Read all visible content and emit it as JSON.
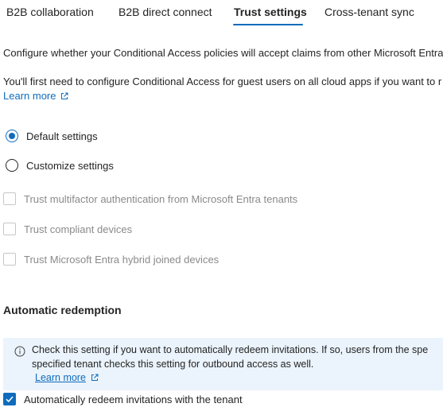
{
  "tabs": [
    {
      "label": "B2B collaboration",
      "active": false
    },
    {
      "label": "B2B direct connect",
      "active": false
    },
    {
      "label": "Trust settings",
      "active": true
    },
    {
      "label": "Cross-tenant sync",
      "active": false
    }
  ],
  "description": {
    "line1": "Configure whether your Conditional Access policies will accept claims from other Microsoft Entra",
    "line2": "You'll first need to configure Conditional Access for guest users on all cloud apps if you want to r",
    "learn_more": "Learn more"
  },
  "settings_mode": {
    "options": [
      {
        "label": "Default settings",
        "checked": true
      },
      {
        "label": "Customize settings",
        "checked": false
      }
    ]
  },
  "trust_options": [
    {
      "label": "Trust multifactor authentication from Microsoft Entra tenants",
      "checked": false,
      "disabled": true
    },
    {
      "label": "Trust compliant devices",
      "checked": false,
      "disabled": true
    },
    {
      "label": "Trust Microsoft Entra hybrid joined devices",
      "checked": false,
      "disabled": true
    }
  ],
  "automatic_redemption": {
    "heading": "Automatic redemption",
    "info_line1": "Check this setting if you want to automatically redeem invitations. If so, users from the spe",
    "info_line2": "specified tenant checks this setting for outbound access as well.",
    "info_learn_more": "Learn more",
    "checkbox_label": "Automatically redeem invitations with the tenant",
    "checkbox_checked": true
  },
  "colors": {
    "accent": "#0f6cbd",
    "info_background": "#ebf3fc",
    "disabled_text": "#8a8a8a"
  }
}
